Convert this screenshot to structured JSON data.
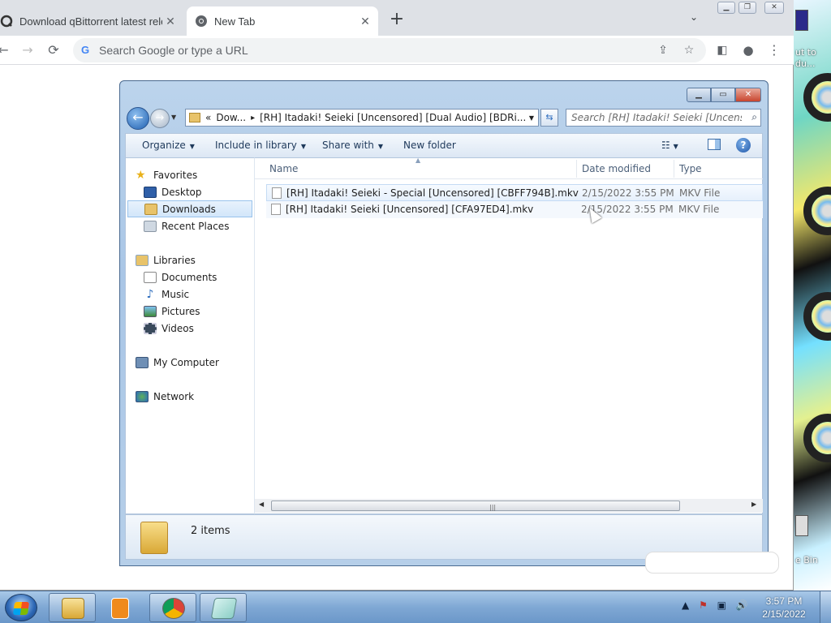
{
  "desktop": {
    "label_top_line1": "ut to",
    "label_top_line2": "du...",
    "label_bottom": "e Bin"
  },
  "browser": {
    "tabs": [
      {
        "title": "Download qBittorrent latest relea",
        "icon": "qbittorrent-icon",
        "active": false
      },
      {
        "title": "New Tab",
        "icon": "chrome-icon",
        "active": true
      }
    ],
    "omnibox_placeholder": "Search Google or type a URL",
    "omnibox_value": ""
  },
  "explorer": {
    "address": {
      "prefix": "«",
      "crumb1": "Dow...",
      "separator": "▸",
      "crumb2": "[RH] Itadaki! Seieki [Uncensored] [Dual Audio] [BDRi..."
    },
    "search_placeholder": "Search [RH] Itadaki! Seieki [Uncensore...",
    "commands": {
      "organize": "Organize",
      "include_in_library": "Include in library",
      "share_with": "Share with",
      "new_folder": "New folder"
    },
    "nav": {
      "favorites": "Favorites",
      "desktop": "Desktop",
      "downloads": "Downloads",
      "recent_places": "Recent Places",
      "libraries": "Libraries",
      "documents": "Documents",
      "music": "Music",
      "pictures": "Pictures",
      "videos": "Videos",
      "my_computer": "My Computer",
      "network": "Network"
    },
    "columns": {
      "name": "Name",
      "date_modified": "Date modified",
      "type": "Type"
    },
    "files": [
      {
        "name": "[RH] Itadaki! Seieki - Special [Uncensored] [CBFF794B].mkv",
        "date": "2/15/2022 3:55 PM",
        "type": "MKV File"
      },
      {
        "name": "[RH] Itadaki! Seieki [Uncensored] [CFA97ED4].mkv",
        "date": "2/15/2022 3:55 PM",
        "type": "MKV File"
      }
    ],
    "item_count": "2 items"
  },
  "taskbar": {
    "apps": [
      "file-explorer-icon",
      "media-player-icon",
      "chrome-icon",
      "notepad-icon"
    ],
    "clock_time": "3:57 PM",
    "clock_date": "2/15/2022"
  }
}
